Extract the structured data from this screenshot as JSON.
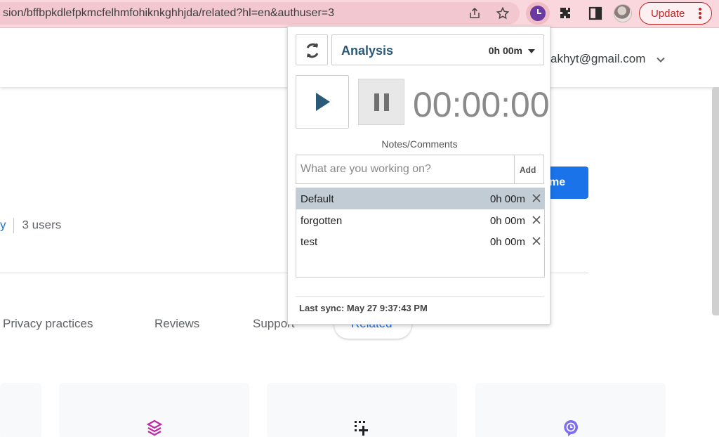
{
  "browser": {
    "url": "sion/bffbpkdlefpkmcfelhmfohiknkghhjda/related?hl=en&authuser=3",
    "update_label": "Update",
    "icons": [
      "share-icon",
      "star-icon",
      "extension-timer-icon",
      "puzzle-icon",
      "side-panel-icon",
      "avatar",
      "kebab-menu-icon"
    ]
  },
  "page": {
    "account_email": "akhyt@gmail.com",
    "blue_button_label": "me",
    "users_prefix": "y",
    "users_count": "3 users",
    "tabs": [
      "Privacy practices",
      "Reviews",
      "Support",
      "Related"
    ]
  },
  "popup": {
    "project": {
      "name": "Analysis",
      "time": "0h 00m"
    },
    "timer": "00:00:00",
    "notes_label": "Notes/Comments",
    "note_placeholder": "What are you working on?",
    "add_label": "Add",
    "tasks": [
      {
        "name": "Default",
        "time": "0h 00m",
        "selected": true
      },
      {
        "name": "forgotten",
        "time": "0h 00m",
        "selected": false
      },
      {
        "name": "test",
        "time": "0h 00m",
        "selected": false
      }
    ],
    "last_sync": "Last sync: May 27 9:37:43 PM"
  },
  "colors": {
    "toolbar_bg": "#f9d7dd",
    "accent_blue": "#1a73e8",
    "project_text": "#2b5a78",
    "update_red": "#c5221f",
    "selected_row": "#c2ccd5"
  }
}
